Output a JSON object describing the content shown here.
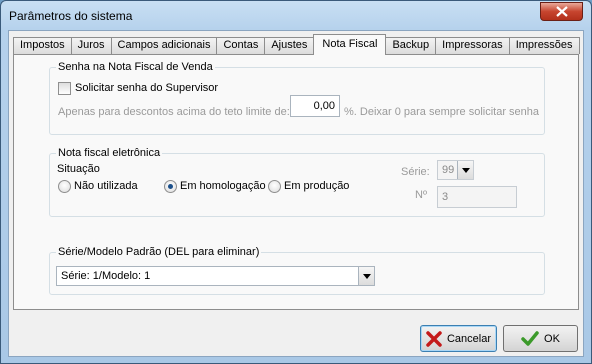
{
  "window": {
    "title": "Parâmetros do sistema"
  },
  "tabs": [
    {
      "label": "Impostos"
    },
    {
      "label": "Juros"
    },
    {
      "label": "Campos adicionais"
    },
    {
      "label": "Contas"
    },
    {
      "label": "Ajustes"
    },
    {
      "label": "Nota Fiscal",
      "active": true
    },
    {
      "label": "Backup"
    },
    {
      "label": "Impressoras"
    },
    {
      "label": "Impressões"
    }
  ],
  "senha_group": {
    "legend": "Senha na Nota Fiscal de Venda",
    "checkbox_label": "Solicitar senha do Supervisor",
    "checkbox_checked": false,
    "desc_before": "Apenas para descontos acima do teto limite de:",
    "teto_value": "0,00",
    "desc_after": "%. Deixar 0 para sempre solicitar senha"
  },
  "nfe_group": {
    "legend": "Nota fiscal eletrônica",
    "situacao_label": "Situação",
    "options": [
      "Não utilizada",
      "Em homologação",
      "Em produção"
    ],
    "selected": "Em homologação",
    "serie_label": "Série:",
    "serie_value": "99",
    "numero_label": "Nº",
    "numero_value": "3"
  },
  "serie_group": {
    "legend": "Série/Modelo Padrão (DEL para eliminar)",
    "selected_value": "Série: 1/Modelo: 1"
  },
  "buttons": {
    "cancel_label": "Cancelar",
    "ok_label": "OK"
  }
}
